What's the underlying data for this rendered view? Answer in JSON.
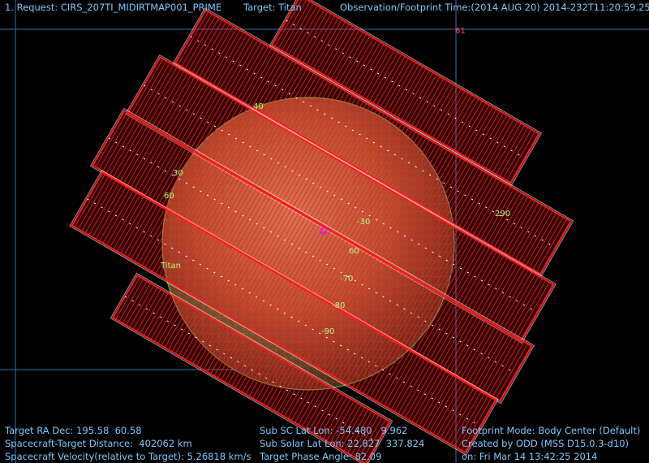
{
  "header": {
    "request": "1. Request: CIRS_207TI_MIDIRTMAP001_PRIME",
    "target": "Target: Titan",
    "obs_time": "Observation/Footprint Time:(2014 AUG 20) 2014-232T11:20:59.25"
  },
  "labels": {
    "titan": "Titan",
    "lat_labels": [
      "30",
      "60",
      "-30",
      "60",
      "-70",
      "-80",
      "-90",
      "290",
      "40"
    ],
    "top_marker": "61"
  },
  "footer": {
    "left": [
      "Target RA Dec: 195.58  60.58",
      "Spacecraft-Target Distance:  402062 km",
      "Spacecraft Velocity(relative to Target): 5.26818 km/s"
    ],
    "middle": [
      "Sub SC Lat Lon: -54.480   9.962",
      "Sub Solar Lat Lon: 22.827  337.824",
      "Target Phase Angle: 82.09"
    ],
    "right": [
      "Footprint Mode: Body Center (Default)",
      "Created by ODD (MSS D15.0.3-d10)",
      "on: Fri Mar 14 13:42:25 2014"
    ]
  },
  "colors": {
    "background": "#000000",
    "hud_text": "#7fc8ff",
    "footprint": "#ff1a1a",
    "outline": "#ffffff",
    "grid": "#76d36a",
    "planet": "#b56a3f"
  }
}
